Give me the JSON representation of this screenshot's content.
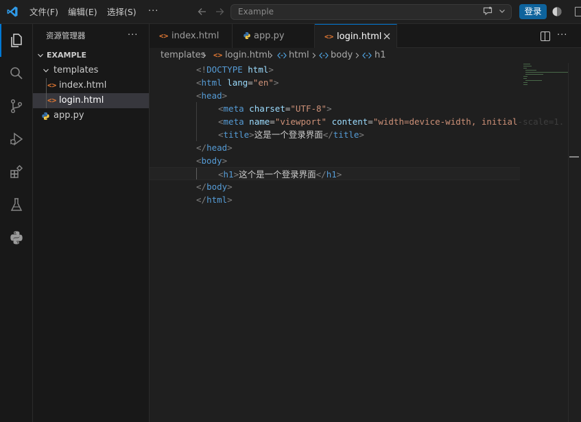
{
  "titlebar": {
    "menus": [
      "文件(F)",
      "编辑(E)",
      "选择(S)"
    ],
    "more": "···",
    "search_placeholder": "Example",
    "login_button": "登录"
  },
  "sidebar": {
    "title": "资源管理器",
    "more": "···",
    "section": "EXAMPLE",
    "tree": [
      {
        "label": "templates",
        "type": "folder",
        "expanded": true
      },
      {
        "label": "index.html",
        "type": "html"
      },
      {
        "label": "login.html",
        "type": "html",
        "selected": true
      },
      {
        "label": "app.py",
        "type": "python"
      }
    ]
  },
  "tabs": [
    {
      "label": "index.html",
      "type": "html"
    },
    {
      "label": "app.py",
      "type": "python"
    },
    {
      "label": "login.html",
      "type": "html",
      "active": true
    }
  ],
  "editor_more": "···",
  "breadcrumbs": [
    "templates",
    "login.html",
    "html",
    "body",
    "h1"
  ],
  "code": {
    "line_numbers": [
      "1",
      "2",
      "3",
      "4",
      "5",
      "6",
      "7",
      "8",
      "9",
      "10",
      "11"
    ],
    "current_line": 9,
    "l1": {
      "open": "<!",
      "doctype": "DOCTYPE",
      "rest": " html",
      "close": ">"
    },
    "l2": {
      "tag": "html",
      "attr": "lang",
      "val": "\"en\""
    },
    "l3": {
      "tag": "head"
    },
    "l4": {
      "tag": "meta",
      "attr": "charset",
      "val": "\"UTF-8\""
    },
    "l5": {
      "tag": "meta",
      "attr1": "name",
      "val1": "\"viewport\"",
      "attr2": "content",
      "val2": "\"width=device-width, initial",
      "overflow": "-scale=1."
    },
    "l6": {
      "tag": "title",
      "text": "这是一个登录界面"
    },
    "l7": {
      "tag": "head"
    },
    "l8": {
      "tag": "body"
    },
    "l9": {
      "tag": "h1",
      "text": "这个是一个登录界面"
    },
    "l10": {
      "tag": "body"
    },
    "l11": {
      "tag": "html"
    }
  },
  "colors": {
    "accent": "#0078d4",
    "tag": "#569cd6",
    "attribute": "#9cdcfe",
    "string": "#ce9178",
    "html_icon": "#e37933",
    "login_button": "#0e639c"
  }
}
